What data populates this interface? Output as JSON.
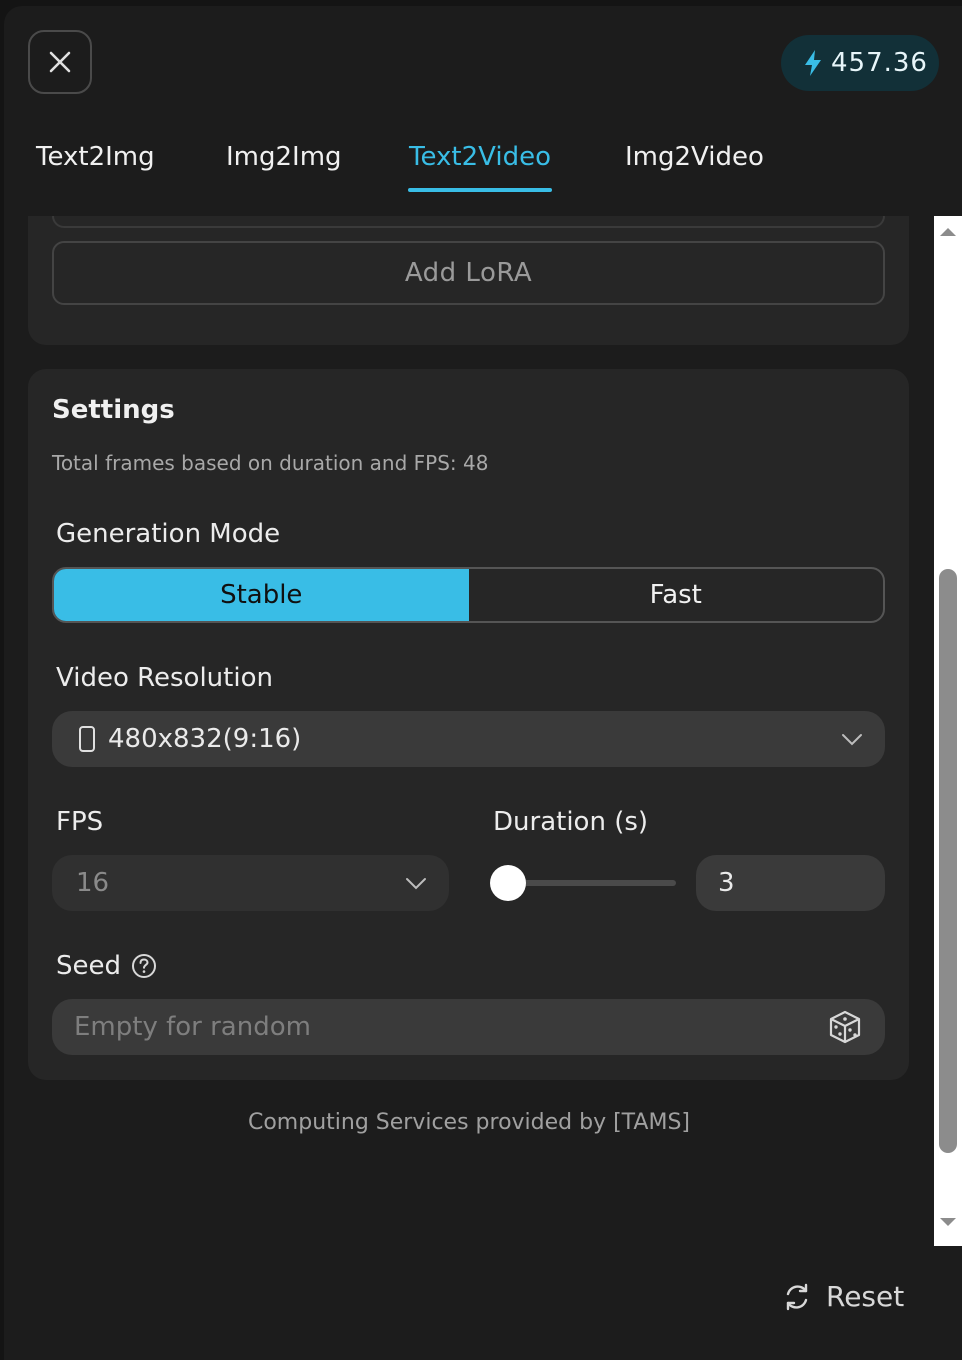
{
  "header": {
    "close_icon": "close-icon",
    "credits_value": "457.36",
    "credits_icon": "lightning-icon",
    "accent": "#39bde6"
  },
  "tabs": [
    {
      "label": "Text2Img",
      "active": false
    },
    {
      "label": "Img2Img",
      "active": false
    },
    {
      "label": "Text2Video",
      "active": true
    },
    {
      "label": "Img2Video",
      "active": false
    }
  ],
  "lora": {
    "add_label": "Add LoRA"
  },
  "settings": {
    "title": "Settings",
    "subtitle": "Total frames based on duration and FPS: 48",
    "generation_mode": {
      "label": "Generation Mode",
      "options": [
        "Stable",
        "Fast"
      ],
      "selected": "Stable"
    },
    "video_resolution": {
      "label": "Video Resolution",
      "value": "480x832(9:16)",
      "icon": "portrait-phone-icon"
    },
    "fps": {
      "label": "FPS",
      "value": "16"
    },
    "duration": {
      "label": "Duration (s)",
      "value": "3",
      "slider_fraction": 0
    },
    "seed": {
      "label": "Seed",
      "help_icon": "help-icon",
      "placeholder": "Empty for random",
      "dice_icon": "dice-icon"
    }
  },
  "footer_note": "Computing Services provided by [TAMS]",
  "reset_label": "Reset"
}
